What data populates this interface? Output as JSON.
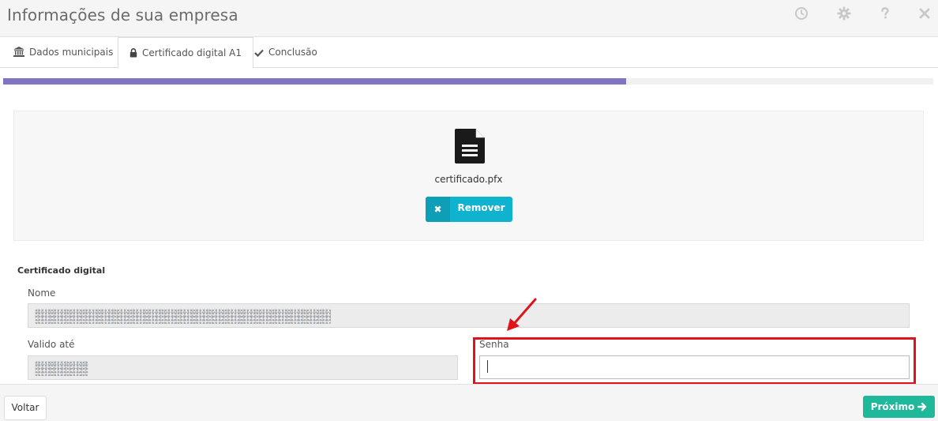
{
  "header": {
    "title": "Informações de sua empresa",
    "icons": [
      "clock-icon",
      "gear-icon",
      "help-icon",
      "close-icon"
    ]
  },
  "tabs": [
    {
      "label": "Dados municipais",
      "icon": "bank-icon",
      "active": false
    },
    {
      "label": "Certificado digital A1",
      "icon": "lock-icon",
      "active": true
    },
    {
      "label": "Conclusão",
      "icon": "check-icon",
      "active": false
    }
  ],
  "progress": {
    "percent": 67,
    "color": "#8074c3"
  },
  "upload": {
    "file_name": "certificado.pfx",
    "remove_label": "Remover"
  },
  "certificate": {
    "section_title": "Certificado digital",
    "name_label": "Nome",
    "valid_label": "Valido até",
    "password_label": "Senha",
    "password_value": ""
  },
  "footer": {
    "back_label": "Voltar",
    "next_label": "Próximo"
  },
  "colors": {
    "accent": "#10b3cf",
    "success": "#1fb89a",
    "highlight": "#e0131b",
    "annotation_arrow": "#e0131b"
  }
}
